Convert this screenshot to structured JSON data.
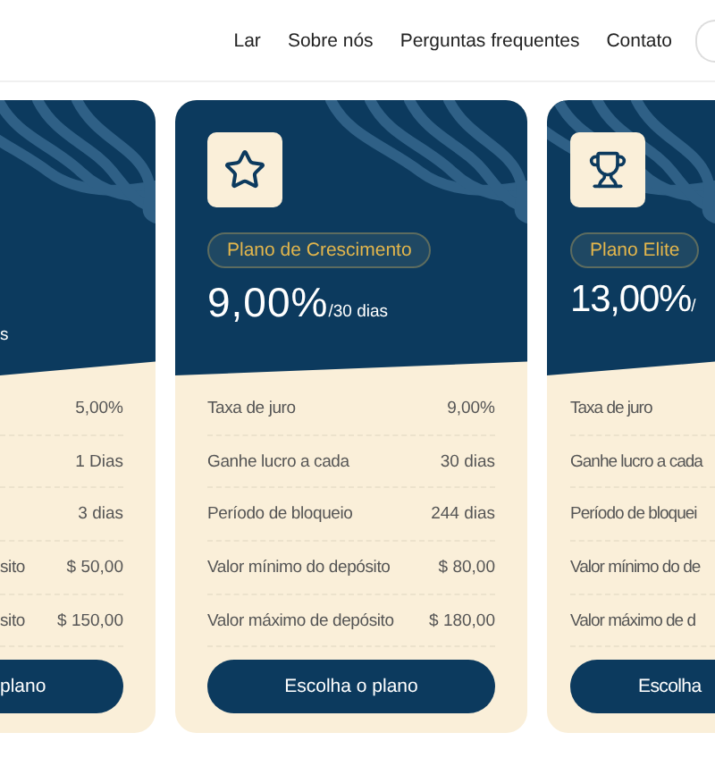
{
  "nav": {
    "links": [
      "Lar",
      "Sobre nós",
      "Perguntas frequentes",
      "Contato"
    ]
  },
  "plans": [
    {
      "period": "s",
      "rows": [
        {
          "value": "5,00%"
        },
        {
          "value": "1 Dias"
        },
        {
          "value": "3 dias"
        },
        {
          "label": "sito",
          "value": "$ 50,00"
        },
        {
          "label": "sito",
          "value": "$ 150,00"
        }
      ],
      "button": "plano"
    },
    {
      "kind": "star",
      "badge": "Plano de Crescimento",
      "rate": "9,00%",
      "period": "/30 dias",
      "rows": [
        {
          "label": "Taxa de juro",
          "value": "9,00%"
        },
        {
          "label": "Ganhe lucro a cada",
          "value": "30 dias"
        },
        {
          "label": "Período de bloqueio",
          "value": "244 dias"
        },
        {
          "label": "Valor mínimo do depósito",
          "value": "$ 80,00"
        },
        {
          "label": "Valor máximo de depósito",
          "value": "$ 180,00"
        }
      ],
      "button": "Escolha o plano"
    },
    {
      "kind": "trophy",
      "badge": "Plano Elite",
      "rate": "13,00%",
      "period": "/",
      "rows": [
        {
          "label": "Taxa de juro"
        },
        {
          "label": "Ganhe lucro a cada"
        },
        {
          "label": "Período de bloquei"
        },
        {
          "label": "Valor mínimo do de"
        },
        {
          "label": "Valor máximo de d"
        }
      ],
      "button": "Escolha"
    }
  ]
}
